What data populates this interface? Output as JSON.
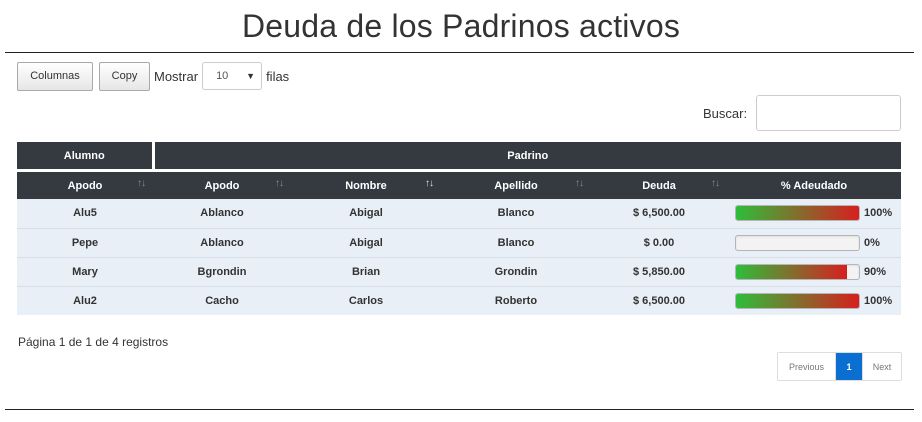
{
  "page": {
    "title": "Deuda de los Padrinos activos"
  },
  "toolbar": {
    "columns_label": "Columnas",
    "copy_label": "Copy",
    "length_prefix": "Mostrar",
    "length_value": "10",
    "length_suffix": "filas"
  },
  "search": {
    "label": "Buscar:",
    "value": "",
    "placeholder": ""
  },
  "table": {
    "groups": {
      "alumno": "Alumno",
      "padrino": "Padrino"
    },
    "columns": [
      {
        "label": "Apodo",
        "sort": "none"
      },
      {
        "label": "Apodo",
        "sort": "none"
      },
      {
        "label": "Nombre",
        "sort": "asc"
      },
      {
        "label": "Apellido",
        "sort": "none"
      },
      {
        "label": "Deuda",
        "sort": "none"
      },
      {
        "label": "% Adeudado",
        "sort": ""
      }
    ],
    "rows": [
      {
        "alumno_apodo": "Alu5",
        "padrino_apodo": "Ablanco",
        "nombre": "Abigal",
        "apellido": "Blanco",
        "deuda": "$ 6,500.00",
        "pct": "100%",
        "pct_value": 100
      },
      {
        "alumno_apodo": "Pepe",
        "padrino_apodo": "Ablanco",
        "nombre": "Abigal",
        "apellido": "Blanco",
        "deuda": "$ 0.00",
        "pct": "0%",
        "pct_value": 0
      },
      {
        "alumno_apodo": "Mary",
        "padrino_apodo": "Bgrondin",
        "nombre": "Brian",
        "apellido": "Grondin",
        "deuda": "$ 5,850.00",
        "pct": "90%",
        "pct_value": 90
      },
      {
        "alumno_apodo": "Alu2",
        "padrino_apodo": "Cacho",
        "nombre": "Carlos",
        "apellido": "Roberto",
        "deuda": "$ 6,500.00",
        "pct": "100%",
        "pct_value": 100
      }
    ]
  },
  "footer": {
    "info": "Página 1 de 1 de 4 registros"
  },
  "pagination": {
    "previous": "Previous",
    "current": "1",
    "next": "Next"
  },
  "colors": {
    "header_bg": "#343a40",
    "row_bg": "#e8eff7",
    "accent": "#0a6fd1",
    "bar_start": "#2ebd3a",
    "bar_end": "#d71f1f"
  },
  "icons": {
    "sort": "sort-arrows-icon",
    "dropdown": "chevron-down-icon"
  }
}
